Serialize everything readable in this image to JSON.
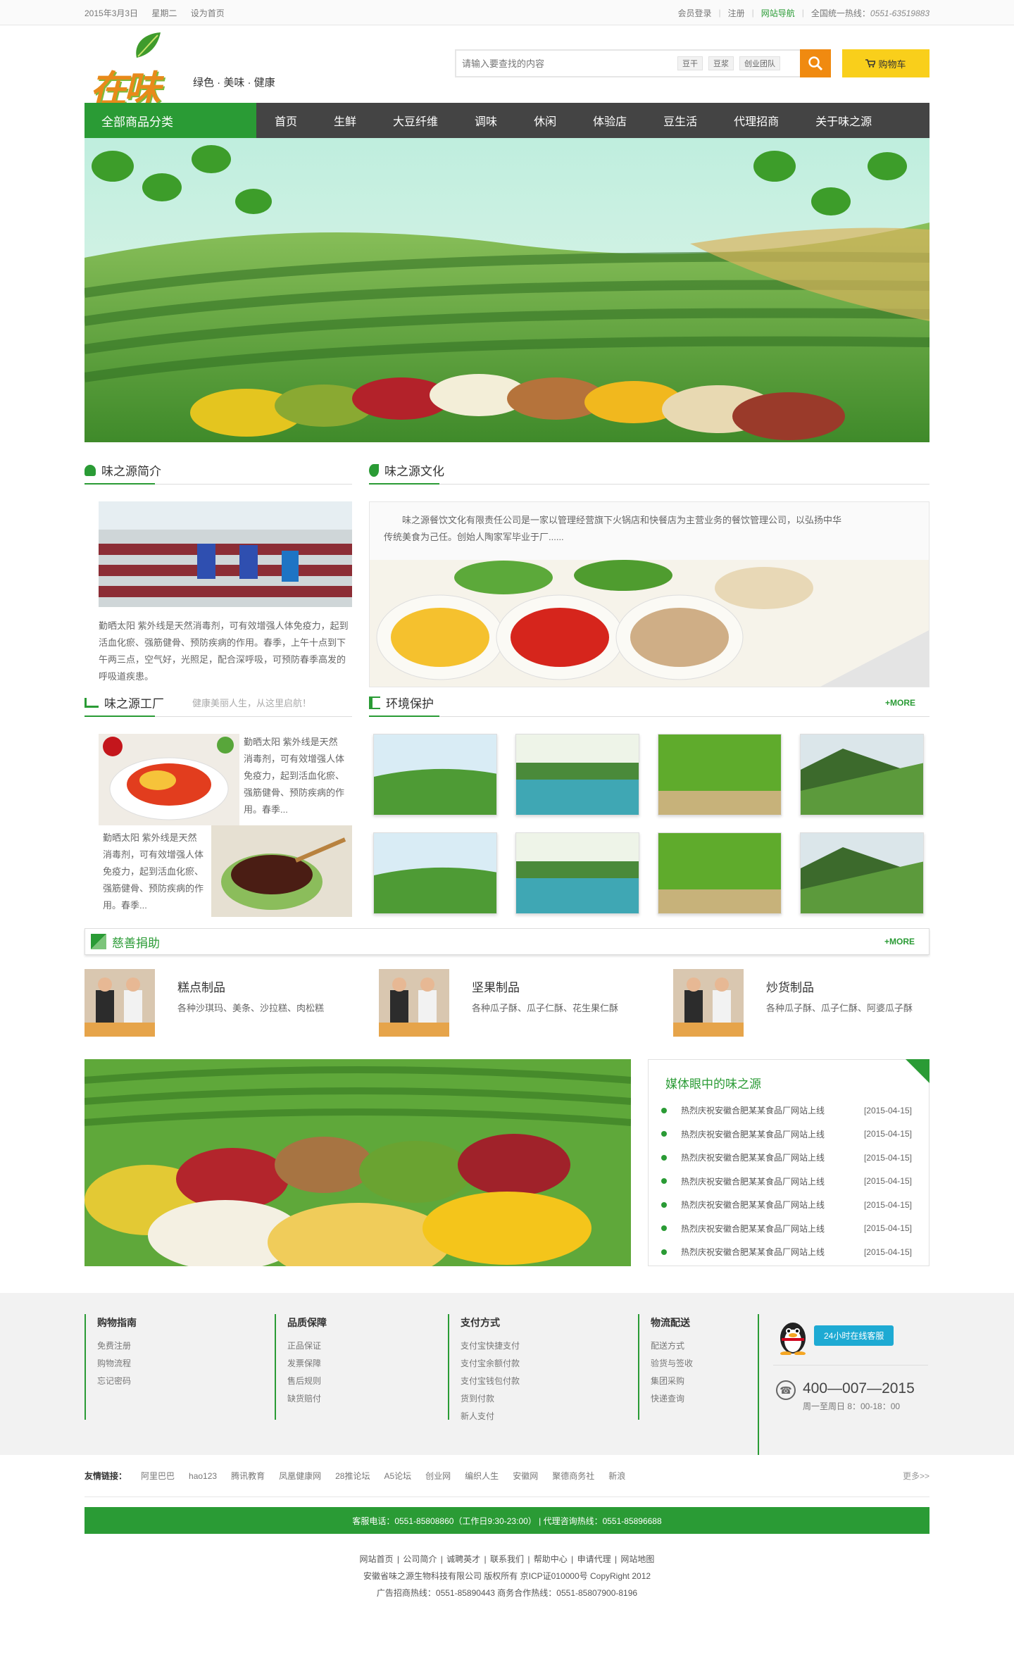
{
  "topbar": {
    "date": "2015年3月3日",
    "weekday": "星期二",
    "set_home": "设为首页",
    "login": "会员登录",
    "register": "注册",
    "site_nav": "网站导航",
    "hotline_label": "全国统一热线：",
    "hotline_number": "0551-63519883"
  },
  "header": {
    "logo_text": "在味",
    "slogan": "绿色 · 美味 · 健康",
    "search_placeholder": "请输入要查找的内容",
    "hot_tags": [
      "豆干",
      "豆浆",
      "创业团队"
    ],
    "cart_label": "购物车"
  },
  "nav": {
    "all_categories": "全部商品分类",
    "items": [
      "首页",
      "生鲜",
      "大豆纤维",
      "调味",
      "休闲",
      "体验店",
      "豆生活",
      "代理招商",
      "关于味之源"
    ]
  },
  "intro": {
    "title": "味之源简介",
    "text": "勤晒太阳 紫外线是天然消毒剂，可有效增强人体免疫力，起到活血化瘀、强筋健骨、预防疾病的作用。春季，上午十点到下午两三点，空气好，光照足，配合深呼吸，可预防春季高发的呼吸道疾患。"
  },
  "culture": {
    "title": "味之源文化",
    "text": "味之源餐饮文化有限责任公司是一家以管理经营旗下火锅店和快餐店为主营业务的餐饮管理公司，以弘扬中华传统美食为己任。创始人陶家军毕业于厂......"
  },
  "factory": {
    "title": "味之源工厂",
    "subtitle": "健康美丽人生，从这里启航！",
    "text1": "勤晒太阳 紫外线是天然消毒剂，可有效增强人体免疫力，起到活血化瘀、强筋健骨、预防疾病的作用。春季...",
    "text2": "勤晒太阳 紫外线是天然消毒剂，可有效增强人体免疫力，起到活血化瘀、强筋健骨、预防疾病的作用。春季..."
  },
  "environment": {
    "title": "环境保护",
    "more": "+MORE"
  },
  "charity": {
    "title": "慈善捐助",
    "more": "+MORE",
    "products": [
      {
        "name": "糕点制品",
        "desc": "各种沙琪玛、美条、沙拉糕、肉松糕"
      },
      {
        "name": "坚果制品",
        "desc": "各种瓜子酥、瓜子仁酥、花生果仁酥"
      },
      {
        "name": "炒货制品",
        "desc": "各种瓜子酥、瓜子仁酥、阿婆瓜子酥"
      }
    ]
  },
  "media": {
    "title": "媒体眼中的味之源",
    "items": [
      {
        "text": "热烈庆祝安徽合肥某某食品厂网站上线",
        "date": "[2015-04-15]"
      },
      {
        "text": "热烈庆祝安徽合肥某某食品厂网站上线",
        "date": "[2015-04-15]"
      },
      {
        "text": "热烈庆祝安徽合肥某某食品厂网站上线",
        "date": "[2015-04-15]"
      },
      {
        "text": "热烈庆祝安徽合肥某某食品厂网站上线",
        "date": "[2015-04-15]"
      },
      {
        "text": "热烈庆祝安徽合肥某某食品厂网站上线",
        "date": "[2015-04-15]"
      },
      {
        "text": "热烈庆祝安徽合肥某某食品厂网站上线",
        "date": "[2015-04-15]"
      },
      {
        "text": "热烈庆祝安徽合肥某某食品厂网站上线",
        "date": "[2015-04-15]"
      }
    ]
  },
  "footer_cols": [
    {
      "title": "购物指南",
      "items": [
        "免费注册",
        "购物流程",
        "忘记密码"
      ]
    },
    {
      "title": "品质保障",
      "items": [
        "正品保证",
        "发票保障",
        "售后规则",
        "缺货赔付"
      ]
    },
    {
      "title": "支付方式",
      "items": [
        "支付宝快捷支付",
        "支付宝余额付款",
        "支付宝钱包付款",
        "货到付款",
        "新人支付"
      ]
    },
    {
      "title": "物流配送",
      "items": [
        "配送方式",
        "验货与签收",
        "集团采购",
        "快递查询"
      ]
    }
  ],
  "service": {
    "online": "24小时在线客服",
    "phone": "400—007—2015",
    "hours": "周一至周日 8：00-18：00"
  },
  "friend_links": {
    "label": "友情链接：",
    "items": [
      "阿里巴巴",
      "hao123",
      "腾讯教育",
      "凤凰健康网",
      "28推论坛",
      "A5论坛",
      "创业网",
      "编织人生",
      "安徽网",
      "聚德商务社",
      "新浪"
    ],
    "more": "更多>>"
  },
  "hotline_bar": "客服电话：0551-85808860（工作日9:30-23:00） | 代理咨询热线：0551-85896688",
  "copyright": {
    "links": [
      "网站首页",
      "公司简介",
      "诚聘英才",
      "联系我们",
      "帮助中心",
      "申请代理",
      "网站地图"
    ],
    "company": "安徽省味之源生物科技有限公司 版权所有 京ICP证010000号 CopyRight 2012",
    "contact": "广告招商热线：0551-85890443 商务合作热线：0551-85807900-8196"
  },
  "colors": {
    "brand_green": "#2a9b35",
    "nav_dark": "#444444",
    "search_orange": "#f08a10",
    "cart_yellow": "#f9cf1b"
  }
}
